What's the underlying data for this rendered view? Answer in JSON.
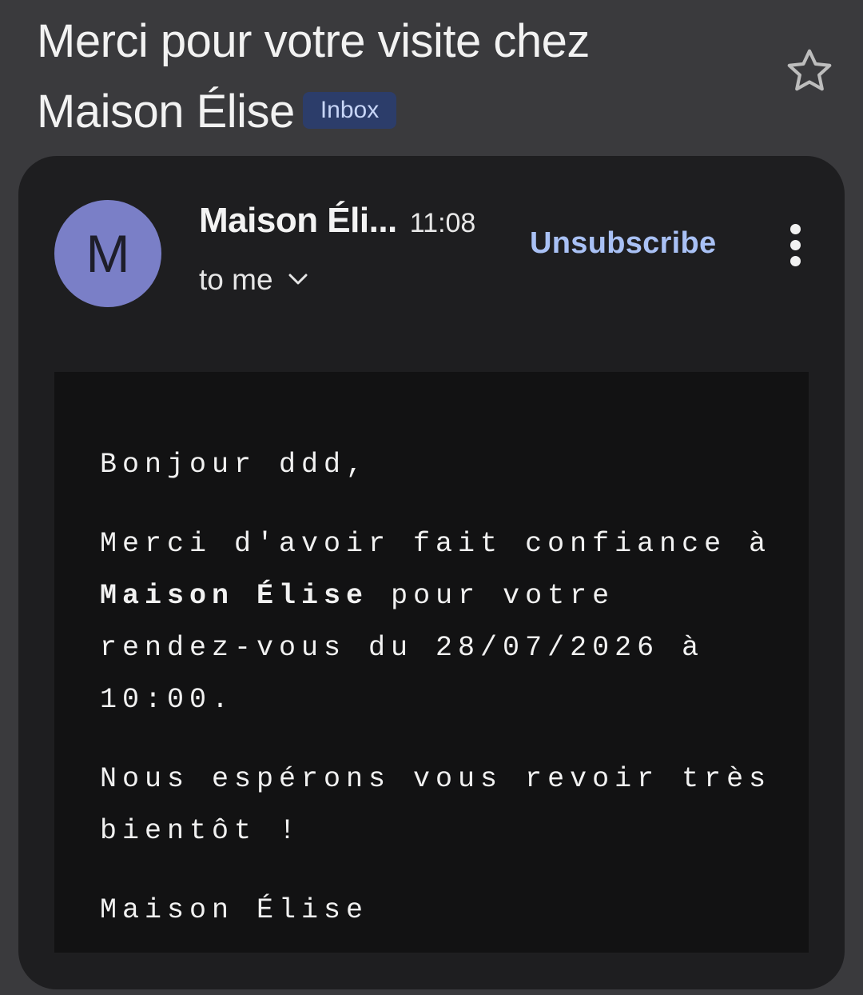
{
  "email": {
    "subject_line1": "Merci pour votre visite chez",
    "subject_line2": "Maison Élise",
    "label_badge": "Inbox",
    "star_icon": "star-outline-icon"
  },
  "header": {
    "avatar_letter": "M",
    "avatar_color": "#7a7fc7",
    "sender_name": "Maison Éli...",
    "time": "11:08",
    "recipient": "to me",
    "unsubscribe_label": "Unsubscribe",
    "more_icon": "more-vertical-icon",
    "unsubscribe_color": "#a9c1f5"
  },
  "body": {
    "greeting": "Bonjour ddd,",
    "thanks_before": "Merci d'avoir fait confiance à",
    "business_name": "Maison Élise",
    "thanks_after": "pour votre rendez-vous du 28/07/2026 à 10:00.",
    "hope": "Nous espérons vous revoir très bientôt !",
    "signature": "Maison Élise"
  }
}
